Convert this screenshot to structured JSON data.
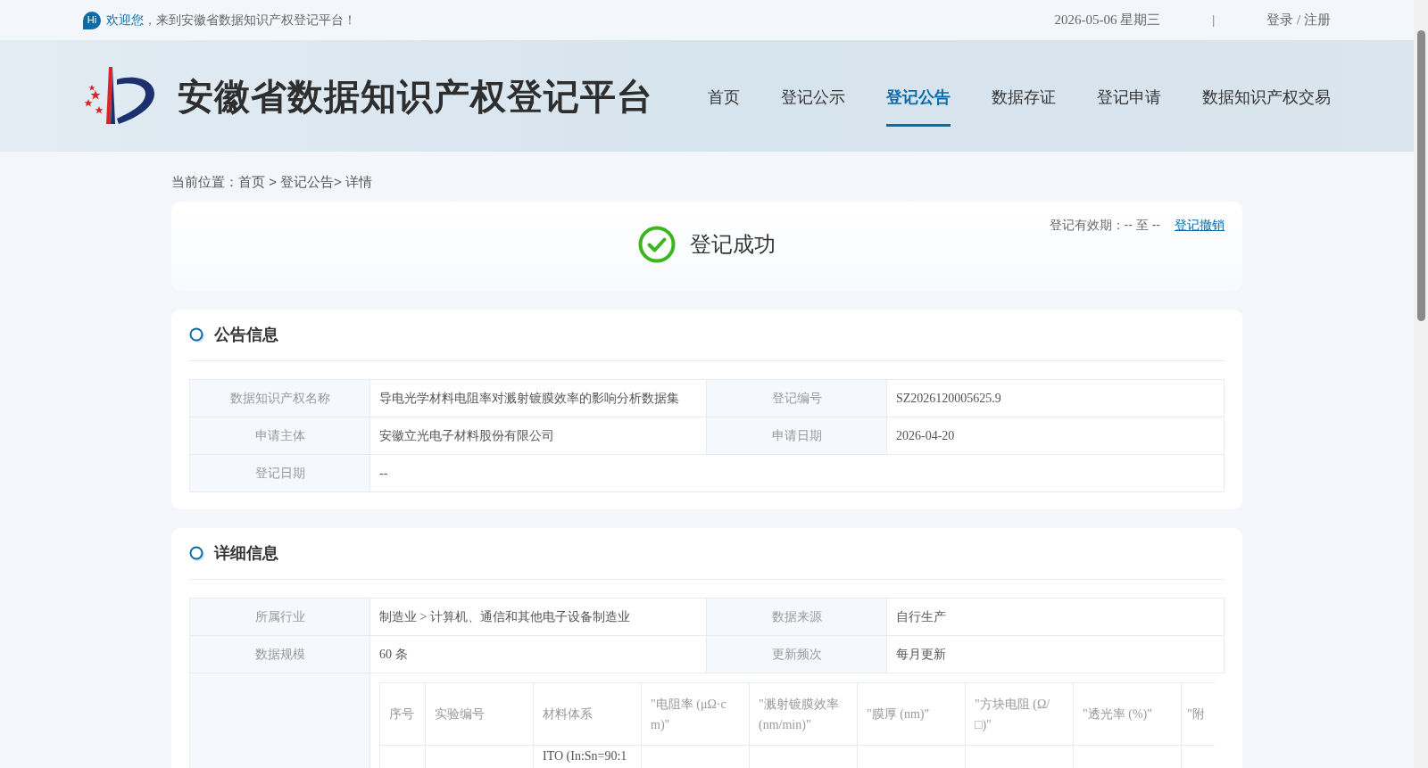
{
  "top_bar": {
    "hi_badge": "Hi",
    "greeting_highlight": "欢迎您",
    "greeting": "，来到安徽省数据知识产权登记平台！",
    "date": "2026-05-06 星期三",
    "separator": "|",
    "auth_link": "登录 / 注册"
  },
  "header": {
    "site_title": "安徽省数据知识产权登记平台",
    "nav": [
      {
        "label": "首页",
        "selected": false
      },
      {
        "label": "登记公示",
        "selected": false
      },
      {
        "label": "登记公告",
        "selected": true
      },
      {
        "label": "数据存证",
        "selected": false
      },
      {
        "label": "登记申请",
        "selected": false
      },
      {
        "label": "数据知识产权交易",
        "selected": false
      }
    ]
  },
  "breadcrumb": "当前位置：首页 > 登记公告> 详情",
  "status_card": {
    "status": "登记成功",
    "validity": "登记有效期：-- 至 --",
    "revoke_link": "登记撤销"
  },
  "sections": [
    {
      "title": "公告信息",
      "rows": [
        {
          "fields": [
            {
              "label": "数据知识产权名称",
              "value": "导电光学材料电阻率对溅射镀膜效率的影响分析数据集"
            },
            {
              "label": "登记编号",
              "value": "SZ2026120005625.9"
            }
          ]
        },
        {
          "fields": [
            {
              "label": "申请主体",
              "value": "安徽立光电子材料股份有限公司"
            },
            {
              "label": "申请日期",
              "value": "2026-04-20"
            }
          ]
        },
        {
          "fields": [
            {
              "label": "登记日期",
              "value": "--"
            }
          ]
        }
      ]
    },
    {
      "title": "详细信息",
      "rows": [
        {
          "fields": [
            {
              "label": "所属行业",
              "value": "制造业 > 计算机、通信和其他电子设备制造业"
            },
            {
              "label": "数据来源",
              "value": "自行生产"
            }
          ]
        },
        {
          "fields": [
            {
              "label": "数据规模",
              "value": "60 条"
            },
            {
              "label": "更新频次",
              "value": "每月更新"
            }
          ]
        }
      ],
      "sample_table": {
        "columns": [
          "序号",
          "实验编号",
          "材料体系",
          "\"电阻率 (μΩ·cm)\"",
          "\"溅射镀膜效率 (nm/min)\"",
          "\"膜厚 (nm)\"",
          "\"方块电阻 (Ω/□)\"",
          "\"透光率 (%)\"",
          "\"附"
        ],
        "rows": [
          {
            "column_3": "ITO (In:Sn=90:1"
          }
        ]
      }
    }
  ]
}
